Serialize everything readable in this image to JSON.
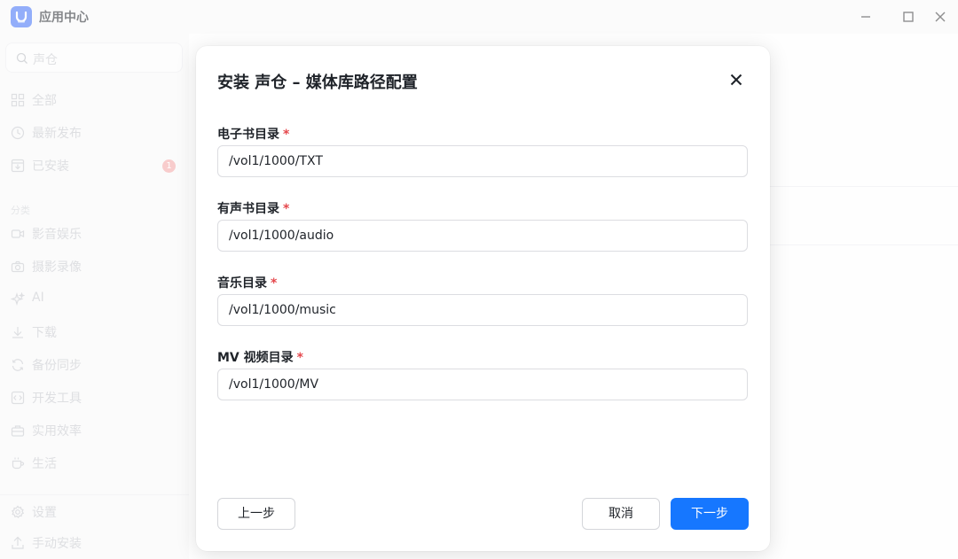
{
  "window": {
    "title": "应用中心"
  },
  "sidebar": {
    "search_placeholder": "声仓",
    "items": [
      {
        "label": "全部",
        "icon": "grid-icon"
      },
      {
        "label": "最新发布",
        "icon": "clock-icon"
      },
      {
        "label": "已安装",
        "icon": "installed-icon",
        "badge": "1"
      }
    ],
    "category_label": "分类",
    "categories": [
      {
        "label": "影音娱乐",
        "icon": "video-icon"
      },
      {
        "label": "摄影录像",
        "icon": "camera-icon"
      },
      {
        "label": "AI",
        "icon": "sparkle-icon"
      },
      {
        "label": "下载",
        "icon": "download-icon"
      },
      {
        "label": "备份同步",
        "icon": "sync-icon"
      },
      {
        "label": "开发工具",
        "icon": "code-icon"
      },
      {
        "label": "实用效率",
        "icon": "toolbox-icon"
      },
      {
        "label": "生活",
        "icon": "cup-icon"
      }
    ],
    "bottom": [
      {
        "label": "设置",
        "icon": "gear-icon"
      },
      {
        "label": "手动安装",
        "icon": "upload-icon"
      }
    ]
  },
  "dialog": {
    "title": "安装 声仓 – 媒体库路径配置",
    "required_mark": "*",
    "fields": [
      {
        "label": "电子书目录",
        "value": "/vol1/1000/TXT"
      },
      {
        "label": "有声书目录",
        "value": "/vol1/1000/audio"
      },
      {
        "label": "音乐目录",
        "value": "/vol1/1000/music"
      },
      {
        "label": "MV 视频目录",
        "value": "/vol1/1000/MV"
      }
    ],
    "prev_label": "上一步",
    "cancel_label": "取消",
    "next_label": "下一步"
  },
  "colors": {
    "primary": "#1677ff",
    "required": "#e5484d",
    "logo": "#3b6cf6"
  }
}
